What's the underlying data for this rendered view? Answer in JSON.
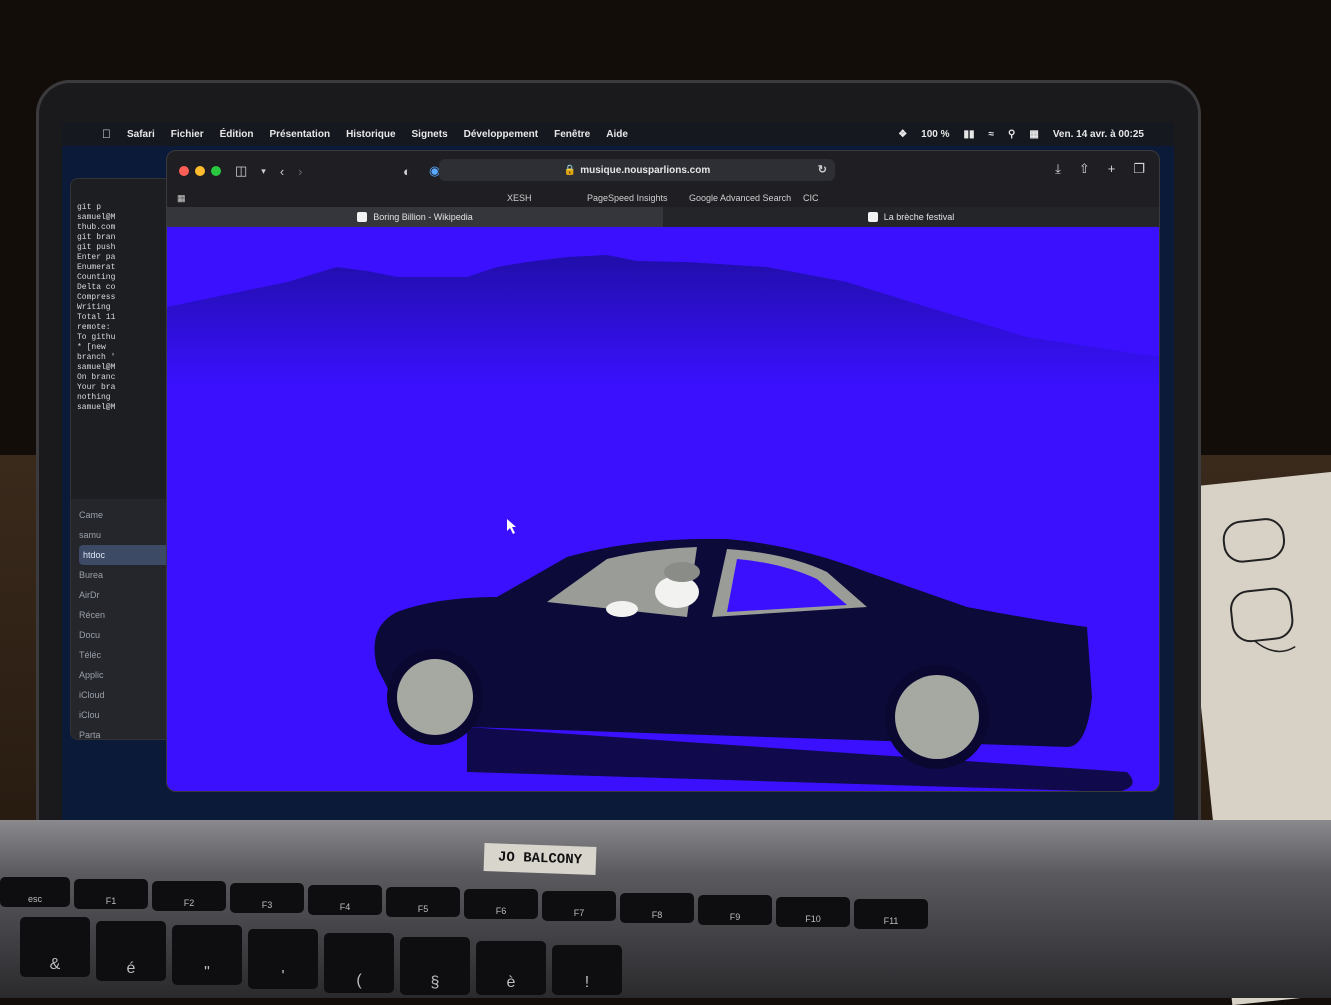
{
  "menubar": {
    "apple_icon": "apple-logo-icon",
    "items": [
      "Safari",
      "Fichier",
      "Édition",
      "Présentation",
      "Historique",
      "Signets",
      "Développement",
      "Fenêtre",
      "Aide"
    ],
    "battery": "100 %",
    "datetime": "Ven. 14 avr. à 00:25"
  },
  "terminal": {
    "lines": [
      "git p",
      "samuel@M",
      "thub.com",
      "git bran",
      "git push",
      "Enter pa",
      "Enumerat",
      "Counting",
      "Delta co",
      "Compress",
      "Writing",
      "Total 11",
      "remote: ",
      "To githu",
      " * [new ",
      "branch '",
      "samuel@M",
      "On branc",
      "Your bra",
      "nothing",
      "samuel@M"
    ]
  },
  "finder": {
    "items": [
      "Came",
      "samu",
      "htdoc",
      "Burea",
      "AirDr",
      "Récen",
      "Docu",
      "Téléc",
      "Applic"
    ],
    "section_label": "iCloud",
    "icloud_items": [
      "iClou",
      "Parta"
    ]
  },
  "browser": {
    "url": "musique.nousparlions.com",
    "favorites": [
      "XESH",
      "PageSpeed Insights",
      "Google Advanced Search",
      "CIC"
    ],
    "tabs": [
      {
        "label": "Boring Billion - Wikipedia",
        "active": true
      },
      {
        "label": "La brèche festival",
        "active": false
      }
    ]
  },
  "page": {
    "background_color": "#3a10ff",
    "car_color": "#0c0a38",
    "wheel_color": "#a6a8a2"
  },
  "laptop": {
    "sticker": "JO BALCONY",
    "keys_row1": [
      "esc",
      "F1",
      "F2",
      "F3",
      "F4",
      "F5",
      "F6",
      "F7",
      "F8",
      "F9",
      "F10",
      "F11"
    ],
    "keys_row2": [
      "&",
      "é",
      "\"",
      "'",
      "(",
      "§",
      "è",
      "!"
    ]
  }
}
